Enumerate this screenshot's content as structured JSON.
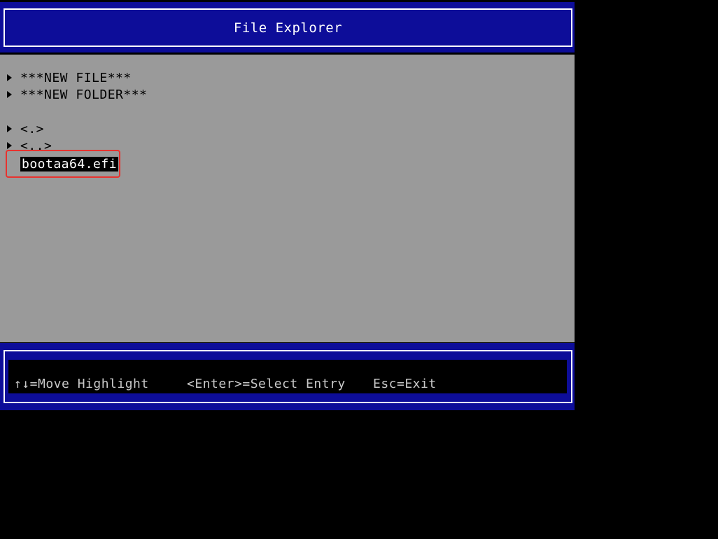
{
  "title": "File Explorer",
  "entries": [
    {
      "label": "***NEW FILE***",
      "has_arrow": true
    },
    {
      "label": "***NEW FOLDER***",
      "has_arrow": true
    },
    {
      "label": "<.>",
      "has_arrow": true
    },
    {
      "label": "<..>",
      "has_arrow": true
    },
    {
      "label": "bootaa64.efi",
      "has_arrow": false,
      "selected": true
    }
  ],
  "footer": {
    "move_hint": "↑↓=Move Highlight",
    "enter_hint": "<Enter>=Select Entry",
    "esc_hint": "Esc=Exit"
  },
  "colors": {
    "bios_blue": "#0d0d99",
    "panel_gray": "#9a9a9a",
    "annotation_red": "#e8322e"
  }
}
